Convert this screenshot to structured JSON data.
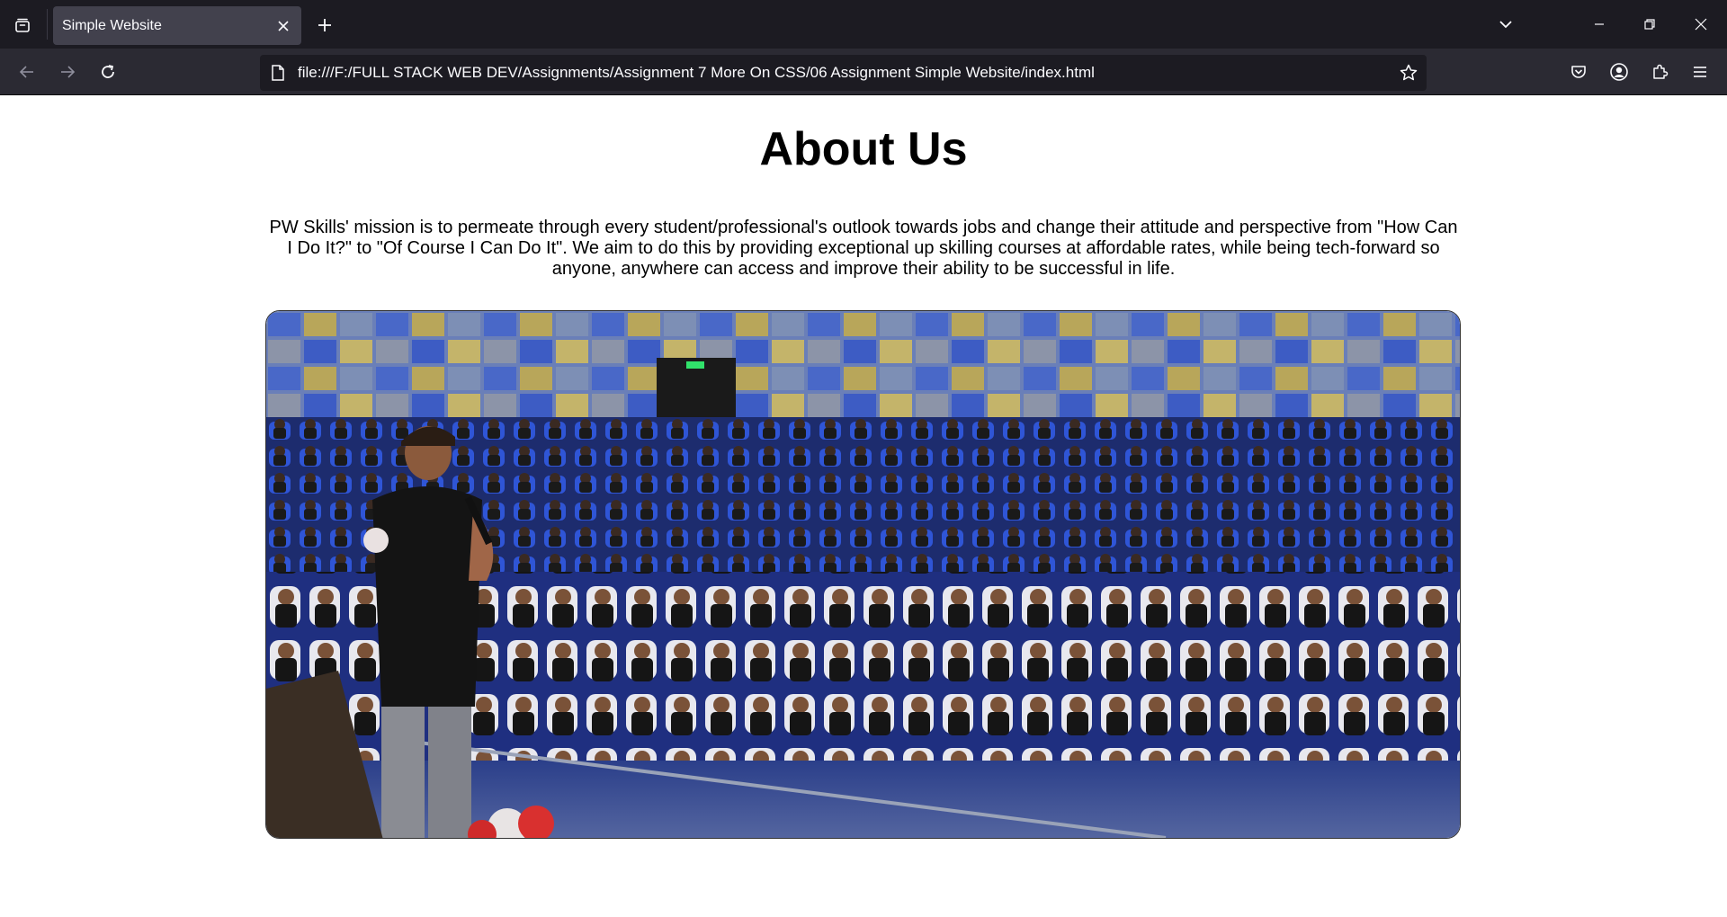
{
  "browser": {
    "tab_title": "Simple Website",
    "url": "file:///F:/FULL STACK WEB DEV/Assignments/Assignment 7 More On CSS/06 Assignment Simple Website/index.html",
    "icons": {
      "tab_list": "tab-list-icon",
      "close_tab": "close-icon",
      "new_tab": "plus-icon",
      "list_all_tabs": "chevron-down-icon",
      "minimize": "minimize-icon",
      "restore": "restore-icon",
      "close_window": "close-icon",
      "back": "arrow-left-icon",
      "forward": "arrow-right-icon",
      "reload": "reload-icon",
      "page": "page-icon",
      "bookmark": "star-icon",
      "pocket": "pocket-icon",
      "account": "account-icon",
      "extensions": "puzzle-icon",
      "menu": "hamburger-icon"
    },
    "colors": {
      "tab_bar": "#1c1b22",
      "nav_bar": "#2b2a33",
      "active_tab": "#42414d",
      "url_field": "#1c1b22",
      "icon": "#fbfbfe"
    }
  },
  "page": {
    "heading": "About Us",
    "intro": "PW Skills' mission is to permeate through every student/professional's outlook towards jobs and change their attitude and perspective from \"How Can I Do It?\" to \"Of Course I Can Do It\". We aim to do this by providing exceptional up skilling courses at affordable rates, while being tech-forward so anyone, anywhere can access and improve their ability to be successful in life.",
    "image_alt": "Speaker addressing a full auditorium of students"
  }
}
